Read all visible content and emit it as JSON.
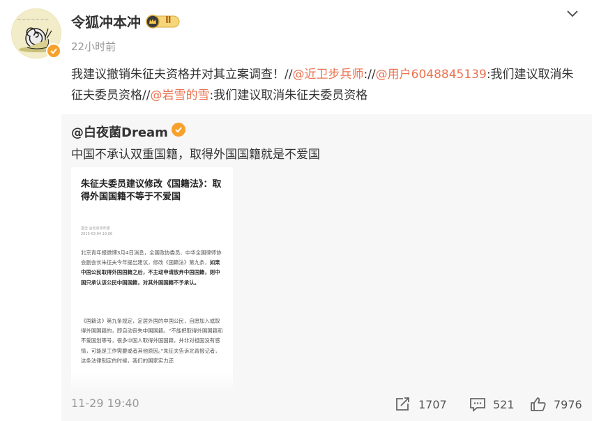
{
  "post": {
    "username": "令狐冲本冲",
    "level_badge": "Ⅱ",
    "avatar_text": "蜗牛",
    "timestamp": "22小时前",
    "text_segments": {
      "t1": "我建议撤销朱征夫资格并对其立案调查！//",
      "m1": "@近卫步兵师",
      "t2": "://",
      "m2": "@用户6048845139",
      "t3": ":我们建议取消朱征夫委员资格//",
      "m3": "@岩雪的雪",
      "t4": ":我们建议取消朱征夫委员资格"
    }
  },
  "repost": {
    "username": "@白夜菌Dream",
    "text": "中国不承认双重国籍，取得外国国籍就是不爱国",
    "article": {
      "title": "朱征夫委员建议修改《国籍法》：取得外国国籍不等于不爱国",
      "source": "直击 @北京青年报\n2019-03-04 19:06",
      "p1_plain": "北京青年报微博3月4日消息，全国政协委员、中华全国律师协会副会长朱征夫今年提出建议，修改《国籍法》第九条，",
      "p1_bold": "如果中国公民取得外国国籍之后，不主动申请放弃中国国籍，则中国只承认该公民中国国籍，对其外国国籍不予承认。",
      "p2": "《国籍法》第九条规定，定居外国的中国公民，自愿加入或取得外国国籍的，即自动丧失中国国籍。“不能把取得外国国籍和不爱国划等号，很多中国人取得外国国籍，并非对祖国没有感情，可能是工作需要或者其他原因。”朱征夫告诉北青报记者，这条法律制定的时候，我们的国家实力还"
    }
  },
  "footer": {
    "time": "11-29 19:40",
    "reposts": "1707",
    "comments": "521",
    "likes": "7976"
  },
  "colors": {
    "mention": "#eb7350",
    "badge": "#f7a12d",
    "secondary": "#999999",
    "repost_bg": "#f7f7f7"
  },
  "icons": [
    "chevron-down-icon",
    "verified-icon",
    "level-crown-icon",
    "repost-icon",
    "comment-icon",
    "like-icon"
  ]
}
